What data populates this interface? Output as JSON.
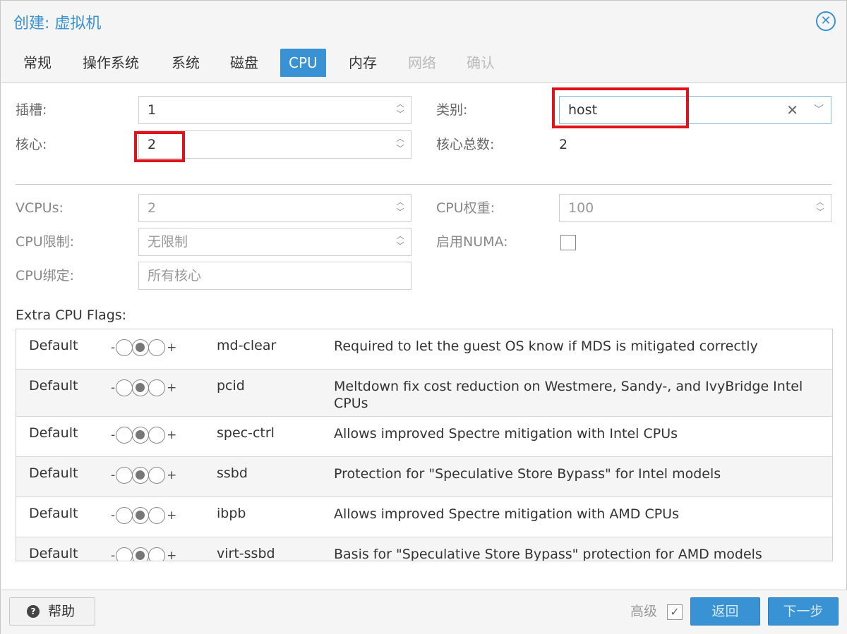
{
  "window": {
    "title": "创建: 虚拟机"
  },
  "tabs": [
    {
      "label": "常规"
    },
    {
      "label": "操作系统"
    },
    {
      "label": "系统"
    },
    {
      "label": "磁盘"
    },
    {
      "label": "CPU"
    },
    {
      "label": "内存"
    },
    {
      "label": "网络"
    },
    {
      "label": "确认"
    }
  ],
  "active_tab": "CPU",
  "form": {
    "sockets": {
      "label": "插槽:",
      "value": "1"
    },
    "cores": {
      "label": "核心:",
      "value": "2"
    },
    "type": {
      "label": "类别:",
      "value": "host"
    },
    "total_cores": {
      "label": "核心总数:",
      "value": "2"
    },
    "vcpus": {
      "label": "VCPUs:",
      "value": "2"
    },
    "cpu_units": {
      "label": "CPU权重:",
      "value": "100"
    },
    "cpu_limit": {
      "label": "CPU限制:",
      "value": "无限制"
    },
    "numa": {
      "label": "启用NUMA:",
      "checked": false
    },
    "cpu_affinity": {
      "label": "CPU绑定:",
      "placeholder": "所有核心"
    }
  },
  "flags": {
    "title": "Extra CPU Flags:",
    "minus": "-",
    "plus": "+",
    "rows": [
      {
        "state": "Default",
        "name": "md-clear",
        "desc": "Required to let the guest OS know if MDS is mitigated correctly"
      },
      {
        "state": "Default",
        "name": "pcid",
        "desc": "Meltdown fix cost reduction on Westmere, Sandy-, and IvyBridge Intel CPUs"
      },
      {
        "state": "Default",
        "name": "spec-ctrl",
        "desc": "Allows improved Spectre mitigation with Intel CPUs"
      },
      {
        "state": "Default",
        "name": "ssbd",
        "desc": "Protection for \"Speculative Store Bypass\" for Intel models"
      },
      {
        "state": "Default",
        "name": "ibpb",
        "desc": "Allows improved Spectre mitigation with AMD CPUs"
      },
      {
        "state": "Default",
        "name": "virt-ssbd",
        "desc": "Basis for \"Speculative Store Bypass\" protection for AMD models"
      }
    ]
  },
  "footer": {
    "help": "帮助",
    "advanced_label": "高级",
    "advanced_checked": true,
    "back": "返回",
    "next": "下一步"
  },
  "colors": {
    "accent": "#3892d3",
    "highlight": "#e0131b"
  }
}
